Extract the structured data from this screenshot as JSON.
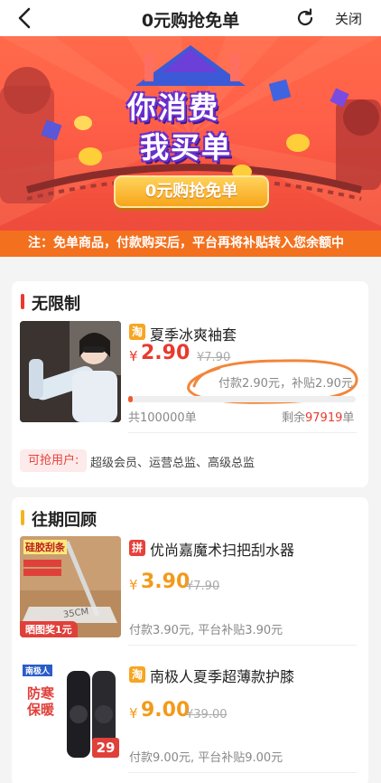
{
  "header": {
    "title": "0元购抢免单",
    "close_label": "关闭"
  },
  "banner": {
    "slogan_line1": "你消费",
    "slogan_line2": "我买单",
    "promo_button": "0元购抢免单",
    "notice": "注：免单商品，付款购买后，平台再将补贴转入您余额中"
  },
  "unlimited": {
    "title": "无限制",
    "product": {
      "platform": "淘",
      "name": "夏季冰爽袖套",
      "currency": "¥",
      "price": "2.90",
      "old_price": "¥7.90",
      "pay_info": "付款2.90元，补贴2.90元",
      "progress": 0.0208,
      "total_text": "共100000单",
      "remaining_prefix": "剩余",
      "remaining_count": "97919",
      "remaining_suffix": "单"
    },
    "eligible_label": "可抢用户:",
    "eligible_users": "超级会员、运营总监、高级总监"
  },
  "history": {
    "title": "往期回顾",
    "items": [
      {
        "platform": "拼",
        "name": "优尚嘉魔术扫把刮水器",
        "currency": "¥",
        "price": "3.90",
        "old_price": "¥7.90",
        "pay_info": "付款3.90元, 平台补贴3.90元",
        "thumb_tag_top": "硅胶刮条",
        "thumb_tag_bottom": "晒图奖1元",
        "thumb_measure": "35CM"
      },
      {
        "platform": "淘",
        "name": "南极人夏季超薄款护膝",
        "currency": "¥",
        "price": "9.00",
        "old_price": "¥39.00",
        "pay_info": "付款9.00元, 平台补贴9.00元",
        "thumb_brand": "南极人",
        "thumb_slogan_1": "防寒",
        "thumb_slogan_2": "保暖",
        "thumb_price_badge": "29"
      }
    ]
  },
  "colors": {
    "accent_red": "#e83a2e",
    "price_orange": "#f39a1a",
    "taobao_tag": "#f6a623",
    "pdd_tag": "#e8413a",
    "eligible_bg": "#fdeaea",
    "bar_yellow": "#f6b31e"
  }
}
